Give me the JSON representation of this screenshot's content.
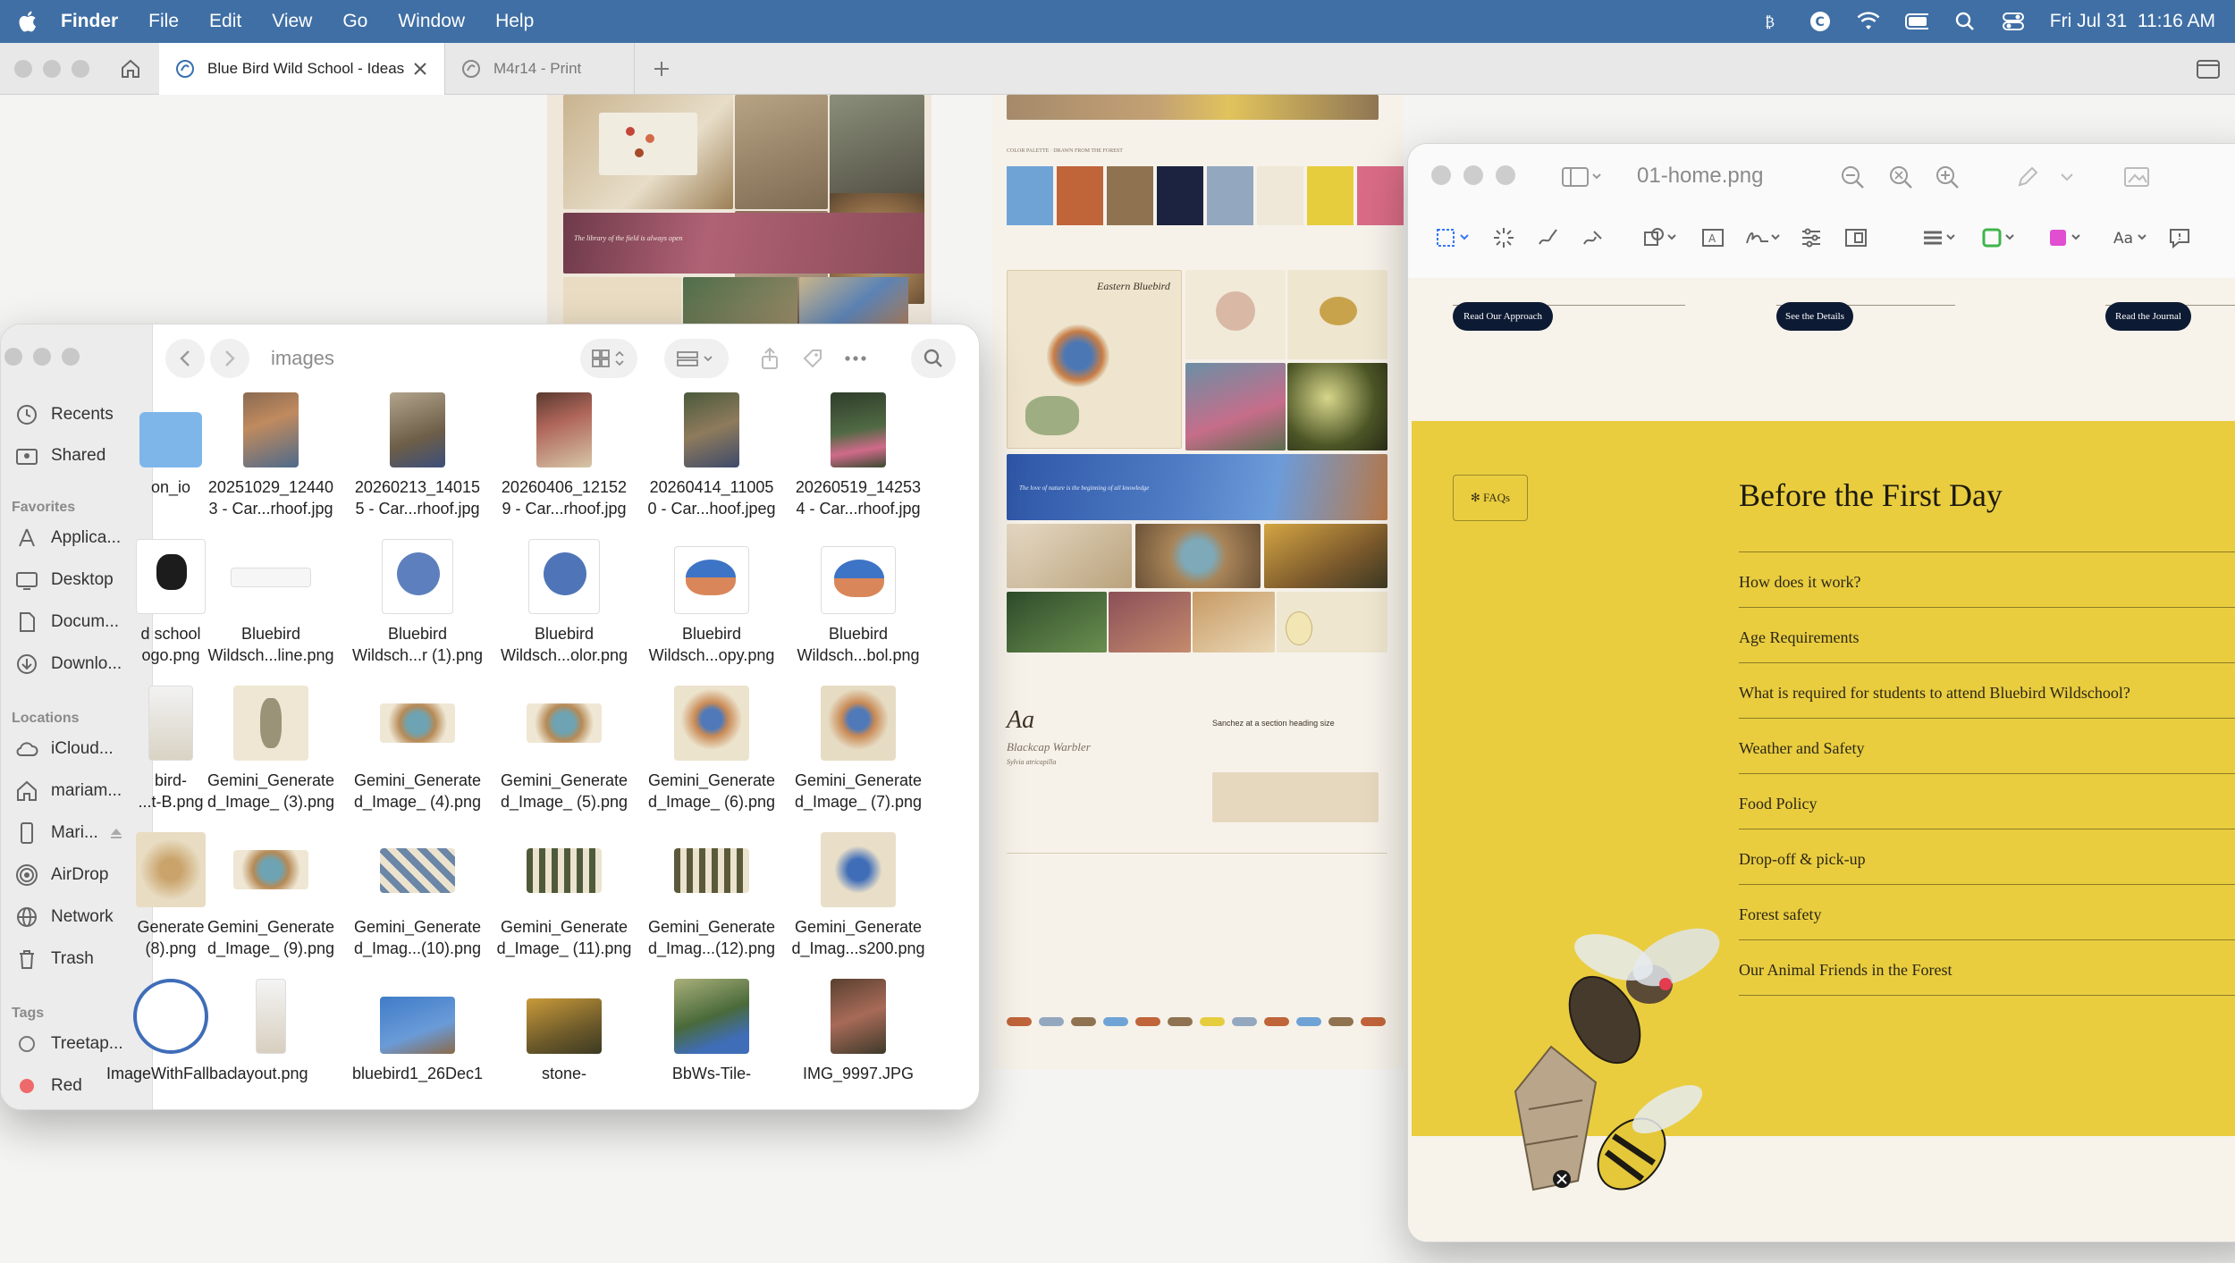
{
  "menubar": {
    "app": "Finder",
    "items": [
      "File",
      "Edit",
      "View",
      "Go",
      "Window",
      "Help"
    ],
    "datetime": "Fri Jul 31  11:16 AM"
  },
  "browser": {
    "tabs": [
      {
        "label": "Blue Bird Wild School - Ideas",
        "active": true
      },
      {
        "label": "M4r14 - Print",
        "active": false
      }
    ]
  },
  "moodboard": {
    "quote_left": "The library of the field is always open",
    "quote_banner": "The love of nature is the beginning of all knowledge",
    "plate_title": "Eastern Bluebird",
    "type_sample": "Aa",
    "type_sample_name": "Blackcap Warbler",
    "type_sample_sub": "Sylvia atricapilla",
    "heading_sample": "Sanchez at a section heading size",
    "swatch_colors": [
      "#6fa3d6",
      "#c0643a",
      "#8f7350",
      "#1c2340",
      "#93a7bf",
      "#efe8d8",
      "#e6cd3e",
      "#d96b86"
    ],
    "chip_colors": [
      "#c0643a",
      "#93a7bf",
      "#8f7350",
      "#6fa3d6",
      "#c0643a",
      "#8f7350",
      "#e6cd3e",
      "#93a7bf",
      "#c0643a",
      "#6fa3d6",
      "#8f7350",
      "#c0643a"
    ]
  },
  "finder": {
    "title": "images",
    "sidebar": {
      "top": [
        {
          "label": "Recents"
        },
        {
          "label": "Shared"
        }
      ],
      "favorites_heading": "Favorites",
      "favorites": [
        {
          "label": "Applica..."
        },
        {
          "label": "Desktop"
        },
        {
          "label": "Docum..."
        },
        {
          "label": "Downlo..."
        }
      ],
      "locations_heading": "Locations",
      "locations": [
        {
          "label": "iCloud..."
        },
        {
          "label": "mariam..."
        },
        {
          "label": "Mari..."
        },
        {
          "label": "AirDrop"
        },
        {
          "label": "Network"
        },
        {
          "label": "Trash"
        }
      ],
      "tags_heading": "Tags",
      "tags": [
        {
          "label": "Treetap..."
        },
        {
          "label": "Red"
        }
      ]
    },
    "files": [
      {
        "line1": "on_io",
        "line2": ""
      },
      {
        "line1": "20251029_12440",
        "line2": "3 - Car...rhoof.jpg"
      },
      {
        "line1": "20260213_14015",
        "line2": "5 - Car...rhoof.jpg"
      },
      {
        "line1": "20260406_12152",
        "line2": "9 - Car...rhoof.jpg"
      },
      {
        "line1": "20260414_11005",
        "line2": "0 - Car...hoof.jpeg"
      },
      {
        "line1": "20260519_14253",
        "line2": "4 - Car...rhoof.jpg"
      },
      {
        "line1": "d school",
        "line2": "ogo.png"
      },
      {
        "line1": "Bluebird",
        "line2": "Wildsch...line.png"
      },
      {
        "line1": "Bluebird",
        "line2": "Wildsch...r (1).png"
      },
      {
        "line1": "Bluebird",
        "line2": "Wildsch...olor.png"
      },
      {
        "line1": "Bluebird",
        "line2": "Wildsch...opy.png"
      },
      {
        "line1": "Bluebird",
        "line2": "Wildsch...bol.png"
      },
      {
        "line1": "bird-",
        "line2": "...t-B.png"
      },
      {
        "line1": "Gemini_Generate",
        "line2": "d_Image_ (3).png"
      },
      {
        "line1": "Gemini_Generate",
        "line2": "d_Image_ (4).png"
      },
      {
        "line1": "Gemini_Generate",
        "line2": "d_Image_ (5).png"
      },
      {
        "line1": "Gemini_Generate",
        "line2": "d_Image_ (6).png"
      },
      {
        "line1": "Gemini_Generate",
        "line2": "d_Image_ (7).png"
      },
      {
        "line1": "Generate",
        "line2": "(8).png"
      },
      {
        "line1": "Gemini_Generate",
        "line2": "d_Image_ (9).png"
      },
      {
        "line1": "Gemini_Generate",
        "line2": "d_Imag...(10).png"
      },
      {
        "line1": "Gemini_Generate",
        "line2": "d_Image_ (11).png"
      },
      {
        "line1": "Gemini_Generate",
        "line2": "d_Imag...(12).png"
      },
      {
        "line1": "Gemini_Generate",
        "line2": "d_Imag...s200.png"
      },
      {
        "line1": "ImageWithFallbac",
        "line2": ""
      },
      {
        "line1": "layout.png",
        "line2": ""
      },
      {
        "line1": "bluebird1_26Dec1",
        "line2": ""
      },
      {
        "line1": "stone-",
        "line2": ""
      },
      {
        "line1": "BbWs-Tile-",
        "line2": ""
      },
      {
        "line1": "IMG_9997.JPG",
        "line2": ""
      }
    ]
  },
  "preview": {
    "title": "01-home.png",
    "buttons": [
      "Read Our Approach",
      "See the Details",
      "Read the Journal"
    ],
    "faq_pill": "✻ FAQs",
    "faq_title": "Before the First Day",
    "faq_questions": [
      "How does it work?",
      "Age Requirements",
      "What is required for students to attend Bluebird Wildschool?",
      "Weather and Safety",
      "Food Policy",
      "Drop-off & pick-up",
      "Forest safety",
      "Our Animal Friends in the Forest"
    ],
    "colors": {
      "panel": "#e9cd3f",
      "button": "#0d1a33"
    }
  }
}
